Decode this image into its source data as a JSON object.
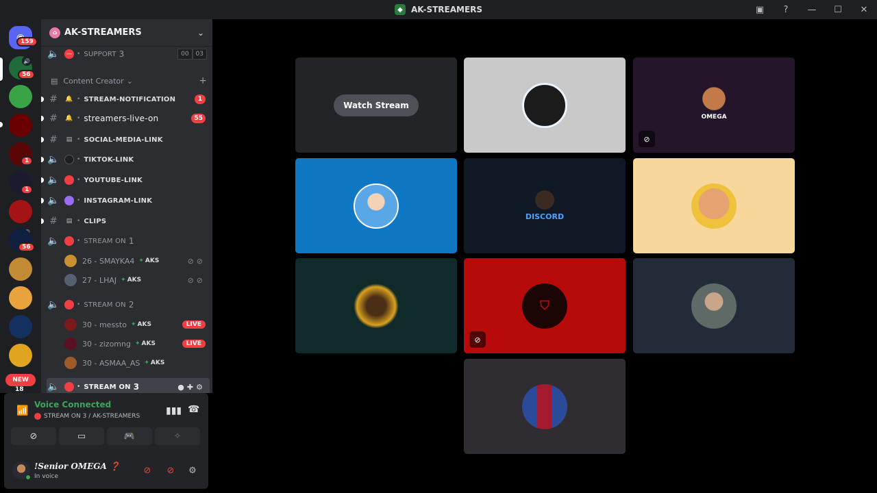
{
  "window": {
    "title": "AK-STREAMERS"
  },
  "rail": {
    "home_badge": "159",
    "servers": [
      {
        "name": "server-1",
        "badge": "56"
      },
      {
        "name": "server-2",
        "badge": ""
      },
      {
        "name": "server-3",
        "badge": ""
      },
      {
        "name": "server-4",
        "badge": "1"
      },
      {
        "name": "server-5",
        "badge": "1"
      },
      {
        "name": "server-6",
        "badge": ""
      },
      {
        "name": "server-7",
        "badge": "56"
      },
      {
        "name": "server-8",
        "badge": ""
      },
      {
        "name": "server-9",
        "badge": ""
      },
      {
        "name": "server-10",
        "badge": ""
      },
      {
        "name": "server-11",
        "badge": ""
      }
    ],
    "new_label": "NEW",
    "new_count": "18"
  },
  "sidebar": {
    "server_name": "AK-STREAMERS",
    "support": {
      "label": "SUPPORT",
      "num": "3",
      "pill_a": "00",
      "pill_b": "03"
    },
    "category": "Content Creator",
    "channels": [
      {
        "label": "STREAM-NOTIFICATION",
        "count": "1"
      },
      {
        "label": "streamers-live-on",
        "count": "55"
      },
      {
        "label": "SOCIAL-MEDIA-LINK"
      },
      {
        "label": "TIKTOK-LINK"
      },
      {
        "label": "YOUTUBE-LINK"
      },
      {
        "label": "INSTAGRAM-LINK"
      },
      {
        "label": "CLIPS"
      }
    ],
    "stream1": {
      "label": "STREAM ON",
      "num": "1"
    },
    "stream1_users": [
      {
        "name": "26 - SMAYKA4",
        "tag": "AKS"
      },
      {
        "name": "27 - LHAJ",
        "tag": "AKS"
      }
    ],
    "stream2": {
      "label": "STREAM ON",
      "num": "2"
    },
    "stream2_users": [
      {
        "name": "30 - messto",
        "tag": "AKS",
        "live": "LIVE"
      },
      {
        "name": "30 - zizomng",
        "tag": "AKS",
        "live": "LIVE"
      },
      {
        "name": "30 - ASMAA_AS",
        "tag": "AKS"
      }
    ],
    "stream3": {
      "label": "STREAM ON",
      "num": "3"
    }
  },
  "voice": {
    "title": "Voice Connected",
    "subtitle": "STREAM ON 3 / AK-STREAMERS"
  },
  "user": {
    "name": "!Senior OMEGA ❓",
    "state": "In voice"
  },
  "stage": {
    "watch_label": "Watch Stream",
    "tiles": [
      {
        "name": "tile-stream",
        "bg": "#232428"
      },
      {
        "name": "tile-user-2",
        "bg": "#c9c9c9",
        "av": "#1b1b1b"
      },
      {
        "name": "tile-user-3",
        "bg": "#24152a",
        "av": "#5a3b22",
        "text": "OMEGA"
      },
      {
        "name": "tile-user-4",
        "bg": "#1077c3",
        "av": "#5aa7e8"
      },
      {
        "name": "tile-user-5",
        "bg": "#0f1824",
        "av": "#1a2a3a",
        "text": "DISCORD"
      },
      {
        "name": "tile-user-6",
        "bg": "#f7d79b",
        "av": "#d98f3e"
      },
      {
        "name": "tile-user-7",
        "bg": "#0f2b29",
        "av": "#3a2a10"
      },
      {
        "name": "tile-user-8",
        "bg": "#b70b0b",
        "av": "#1c0505"
      },
      {
        "name": "tile-user-9",
        "bg": "#232b38",
        "av": "#5e6a66"
      },
      {
        "name": "tile-user-10",
        "bg": "#2f2d31",
        "av": "#2c4a9a"
      }
    ]
  },
  "colors": {
    "accent_green": "#3ba55c",
    "badge_red": "#f23f43"
  }
}
